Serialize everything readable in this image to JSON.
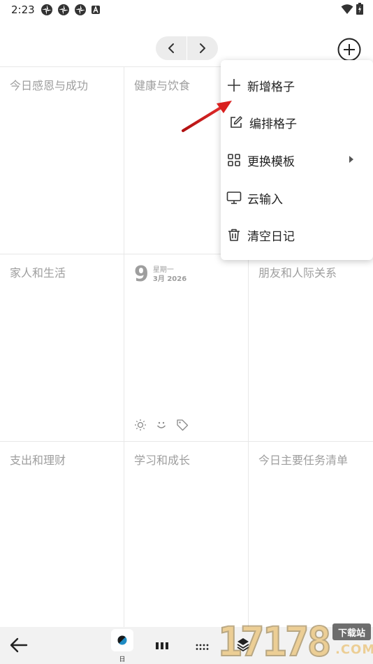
{
  "status_bar": {
    "time": "2:23",
    "notification_icons": [
      "pinwheel-icon",
      "pinwheel-icon",
      "pinwheel-icon",
      "a-badge-icon"
    ],
    "right_icons": [
      "wifi-icon",
      "battery-charging-icon"
    ]
  },
  "topbar": {
    "prev_icon": "chevron-left-icon",
    "next_icon": "chevron-right-icon",
    "add_icon": "add-circle-icon"
  },
  "grid": {
    "cells": [
      {
        "title": "今日感恩与成功"
      },
      {
        "title": "健康与饮食"
      },
      {
        "title": ""
      },
      {
        "title": "家人和生活"
      },
      {
        "title": ""
      },
      {
        "title": "朋友和人际关系"
      },
      {
        "title": "支出和理财"
      },
      {
        "title": "学习和成长"
      },
      {
        "title": "今日主要任务清单"
      }
    ],
    "date": {
      "day": "9",
      "weekday": "星期一",
      "month_year": "3月 2026",
      "icons": [
        "sun-icon",
        "smile-icon",
        "tag-icon"
      ]
    }
  },
  "menu": {
    "items": [
      {
        "label": "新增格子",
        "icon": "plus-icon"
      },
      {
        "label": "编排格子",
        "icon": "edit-icon"
      },
      {
        "label": "更换模板",
        "icon": "grid-icon",
        "has_submenu": true
      },
      {
        "label": "云输入",
        "icon": "monitor-icon"
      },
      {
        "label": "清空日记",
        "icon": "trash-icon"
      }
    ]
  },
  "bottom_bar": {
    "back_icon": "arrow-left-icon",
    "day_label": "日",
    "views": [
      "day-view-icon",
      "week-view-icon",
      "month-view-icon",
      "layers-icon"
    ]
  },
  "watermark": {
    "digits": "17178",
    "badge": "下载站",
    "suffix": ".COM"
  },
  "colors": {
    "accent_red": "#d9201f",
    "grid_line": "#e8e8e8",
    "title_gray": "#9e9e9e",
    "bar_bg": "#f2f2f2"
  }
}
